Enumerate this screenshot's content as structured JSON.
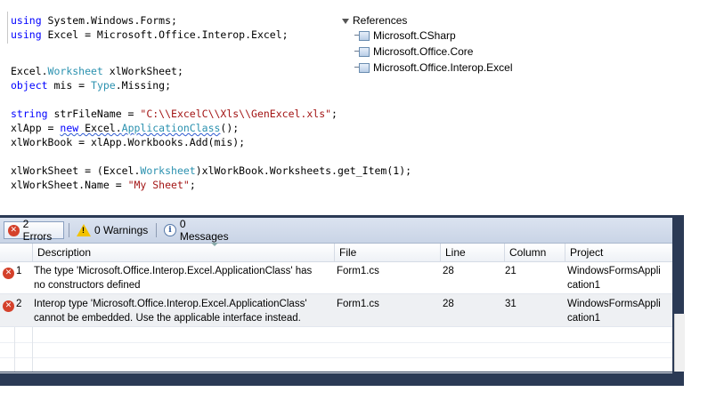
{
  "code": {
    "line1": {
      "kw": "using",
      "rest": " System.Windows.Forms;"
    },
    "line2": {
      "kw": "using",
      "rest": " Excel = Microsoft.Office.Interop.Excel;"
    },
    "line3": {
      "a": "Excel.",
      "ty": "Worksheet",
      "b": " xlWorkSheet;"
    },
    "line4": {
      "kw": "object",
      "a": " mis = ",
      "ty": "Type",
      "b": ".Missing;"
    },
    "line5": {
      "kw": "string",
      "a": " strFileName = ",
      "str": "\"C:\\\\ExcelC\\\\Xls\\\\GenExcel.xls\"",
      "b": ";"
    },
    "line6": {
      "a": "xlApp = ",
      "kw": "new",
      "sq1": " Excel.",
      "sq2": "ApplicationClass",
      "b": "();"
    },
    "line7": {
      "a": "xlWorkBook = xlApp.Workbooks.Add(mis);"
    },
    "line8": {
      "a": "xlWorkSheet = (Excel.",
      "ty": "Worksheet",
      "b": ")xlWorkBook.Worksheets.get_Item(1);"
    },
    "line9": {
      "a": "xlWorkSheet.Name = ",
      "str": "\"My Sheet\"",
      "b": ";"
    }
  },
  "references": {
    "root": "References",
    "items": [
      "Microsoft.CSharp",
      "Microsoft.Office.Core",
      "Microsoft.Office.Interop.Excel"
    ]
  },
  "error_list": {
    "errors_label": "2 Errors",
    "warnings_label": "0 Warnings",
    "messages_label": "0 Messages",
    "columns": [
      "Description",
      "File",
      "Line",
      "Column",
      "Project"
    ],
    "rows": [
      {
        "num": "1",
        "desc1": "The type 'Microsoft.Office.Interop.Excel.ApplicationClass' has",
        "desc2": "no constructors defined",
        "file": "Form1.cs",
        "line": "28",
        "column": "21",
        "proj1": "WindowsFormsAppli",
        "proj2": "cation1"
      },
      {
        "num": "2",
        "desc1": "Interop type 'Microsoft.Office.Interop.Excel.ApplicationClass'",
        "desc2": "cannot be embedded. Use the applicable interface instead.",
        "file": "Form1.cs",
        "line": "28",
        "column": "31",
        "proj1": "WindowsFormsAppli",
        "proj2": "cation1"
      }
    ]
  },
  "colors": {
    "error": "#d4412b",
    "keyword": "#0000ff",
    "type": "#2b91af",
    "string": "#a31515"
  },
  "icons": {
    "error": "x-circle-icon",
    "warning": "warning-triangle-icon",
    "info": "info-icon",
    "reference": "reference-icon"
  }
}
